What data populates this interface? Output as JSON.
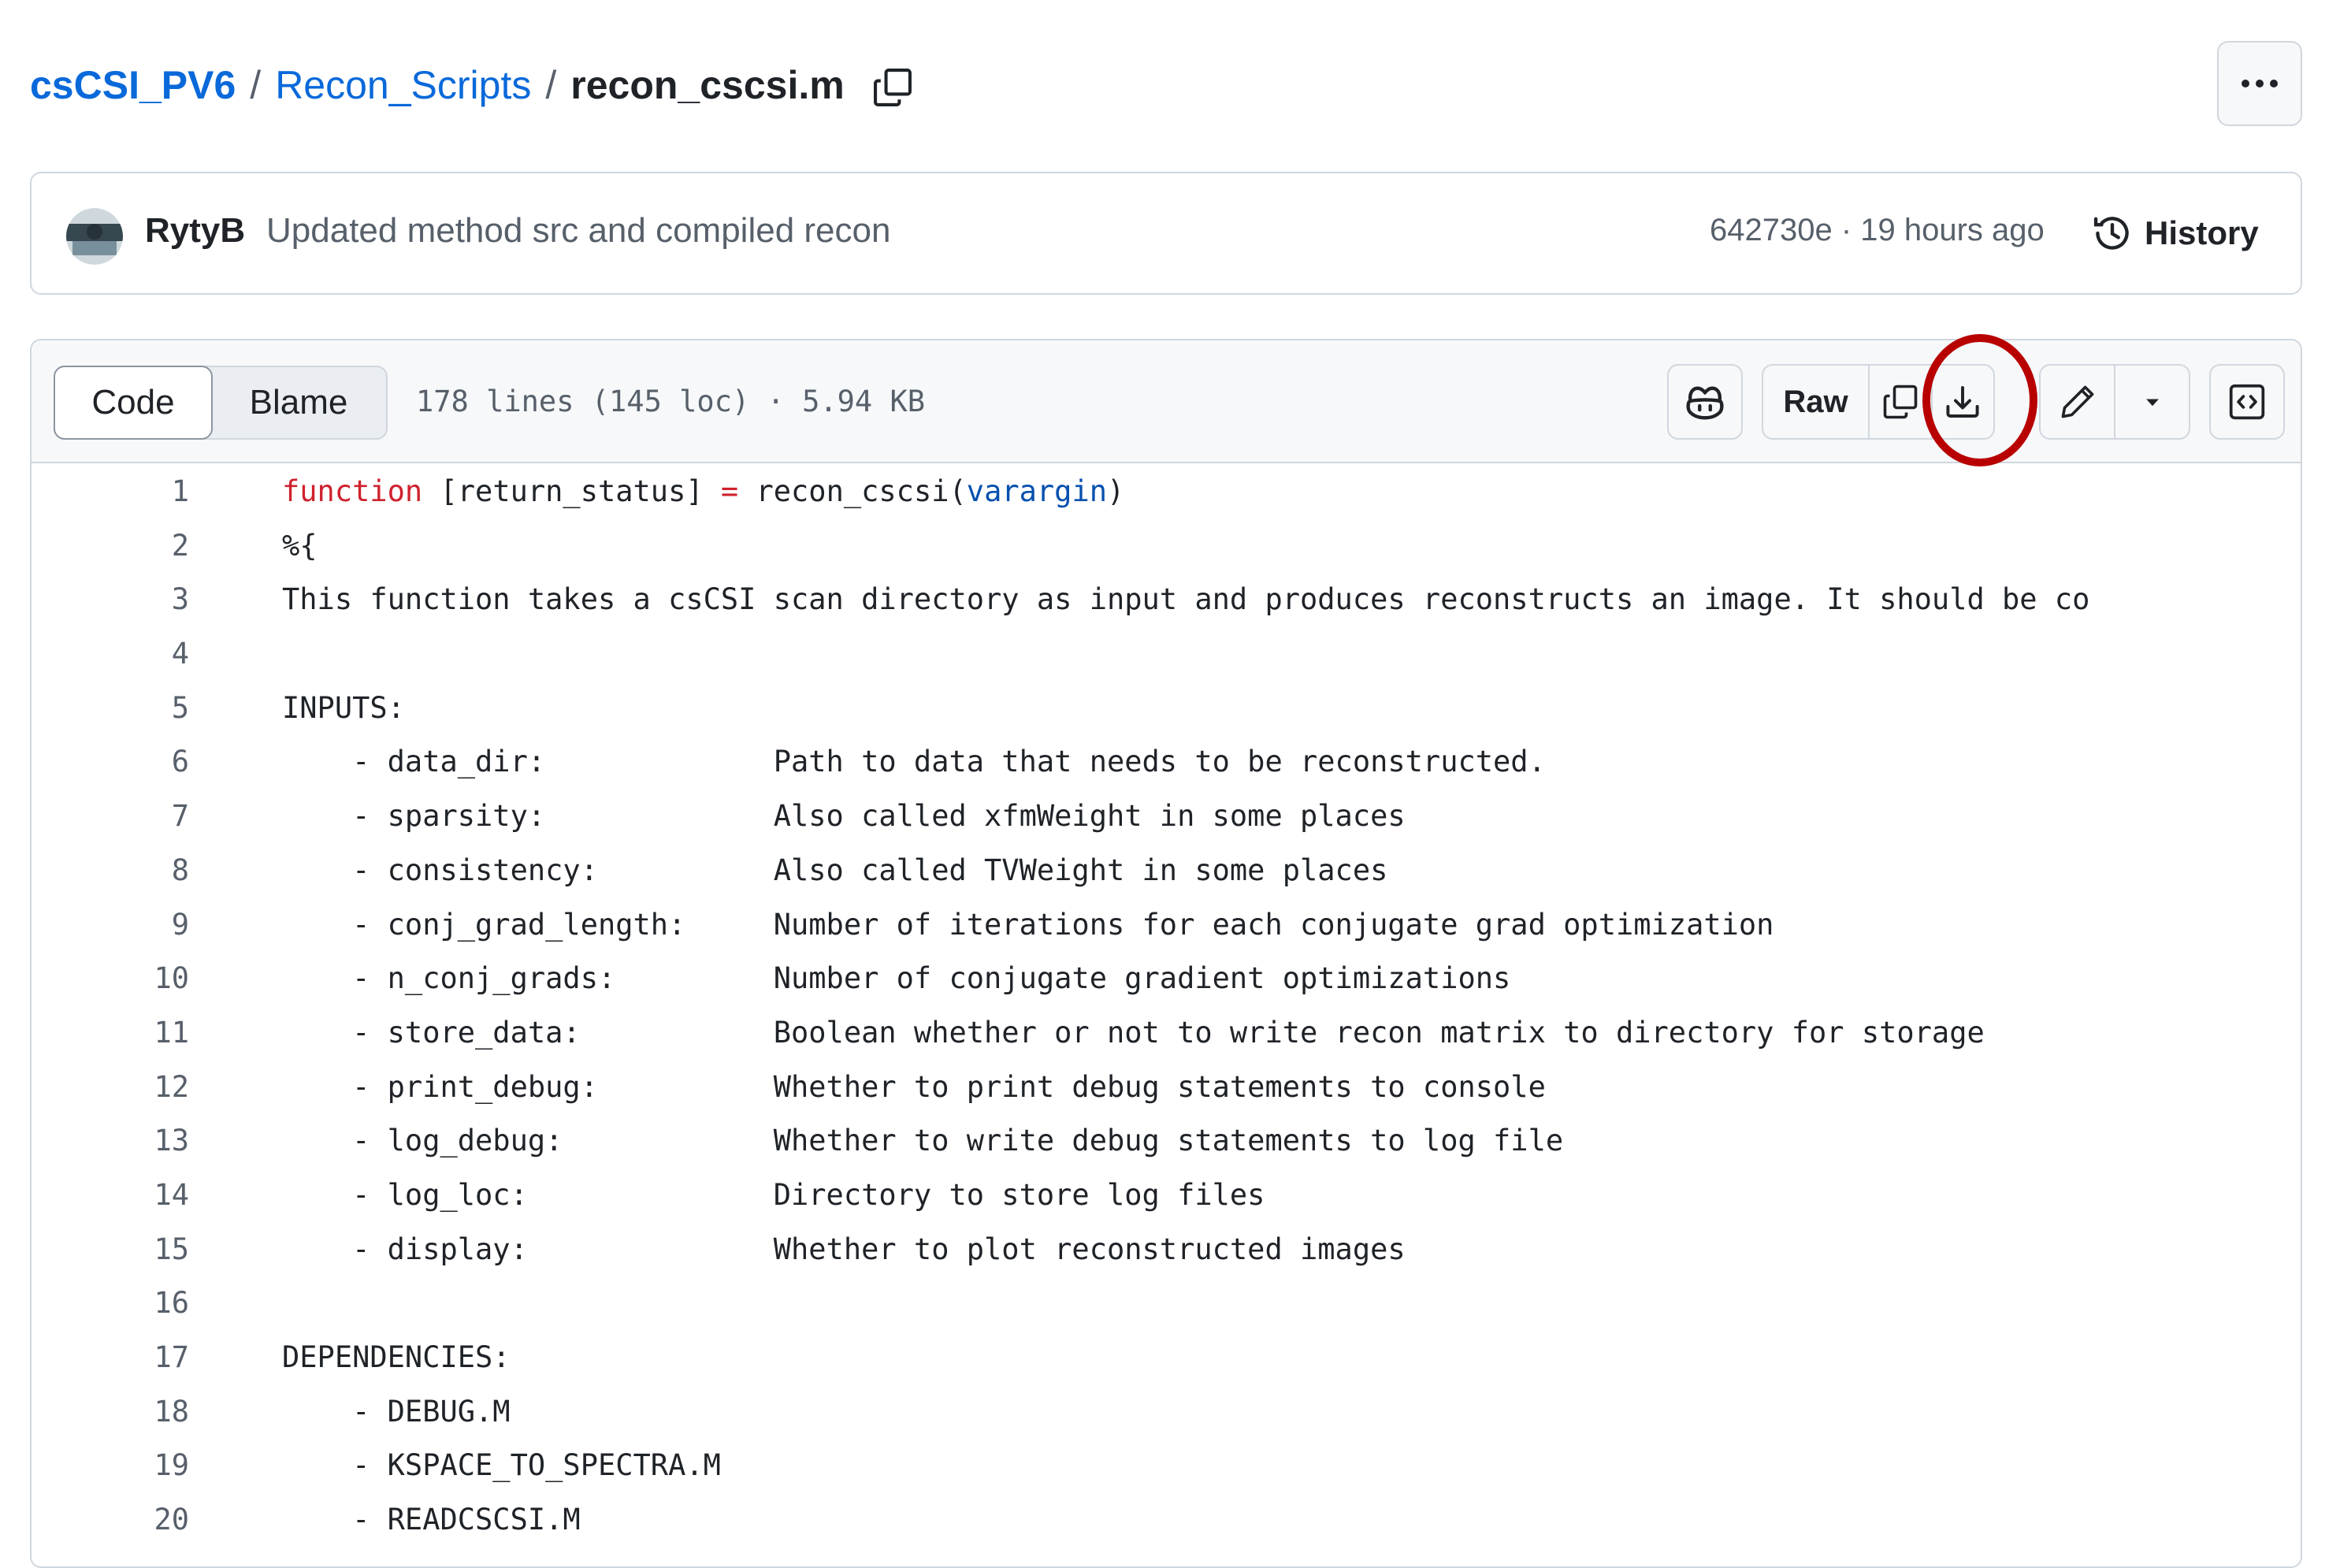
{
  "breadcrumb": {
    "repo": "csCSI_PV6",
    "separator": "/",
    "folder": "Recon_Scripts",
    "file": "recon_cscsi.m"
  },
  "icons": {
    "copy_path": "copy-icon",
    "more": "kebab-horizontal-icon",
    "history": "history-clock-icon",
    "copilot": "copilot-icon",
    "copy_raw": "copy-icon",
    "download": "download-icon",
    "edit": "pencil-icon",
    "edit_dropdown": "triangle-down-icon",
    "symbols": "code-square-icon"
  },
  "commit": {
    "author": "RytyB",
    "message": "Updated method src and compiled recon",
    "meta": "642730e · 19 hours ago",
    "history_label": "History"
  },
  "file_header": {
    "tabs": [
      "Code",
      "Blame"
    ],
    "active_tab": "Code",
    "info": "178 lines (145 loc) · 5.94 KB",
    "raw_label": "Raw"
  },
  "colors": {
    "link": "#0969da",
    "keyword": "#cf222e",
    "builtin": "#0550ae",
    "highlight_ring": "#b80000"
  },
  "code": {
    "line1": {
      "num": "1",
      "kw": "function",
      "mid": " [return_status] ",
      "op": "=",
      "fn": " recon_cscsi(",
      "arg": "varargin",
      "end": ")"
    },
    "lines": [
      {
        "num": "2",
        "text": "%{"
      },
      {
        "num": "3",
        "text": "This function takes a csCSI scan directory as input and produces reconstructs an image. It should be co"
      },
      {
        "num": "4",
        "text": ""
      },
      {
        "num": "5",
        "text": "INPUTS:"
      },
      {
        "num": "6",
        "text": "    - data_dir:             Path to data that needs to be reconstructed."
      },
      {
        "num": "7",
        "text": "    - sparsity:             Also called xfmWeight in some places"
      },
      {
        "num": "8",
        "text": "    - consistency:          Also called TVWeight in some places"
      },
      {
        "num": "9",
        "text": "    - conj_grad_length:     Number of iterations for each conjugate grad optimization"
      },
      {
        "num": "10",
        "text": "    - n_conj_grads:         Number of conjugate gradient optimizations"
      },
      {
        "num": "11",
        "text": "    - store_data:           Boolean whether or not to write recon matrix to directory for storage"
      },
      {
        "num": "12",
        "text": "    - print_debug:          Whether to print debug statements to console"
      },
      {
        "num": "13",
        "text": "    - log_debug:            Whether to write debug statements to log file"
      },
      {
        "num": "14",
        "text": "    - log_loc:              Directory to store log files"
      },
      {
        "num": "15",
        "text": "    - display:              Whether to plot reconstructed images"
      },
      {
        "num": "16",
        "text": ""
      },
      {
        "num": "17",
        "text": "DEPENDENCIES:"
      },
      {
        "num": "18",
        "text": "    - DEBUG.M"
      },
      {
        "num": "19",
        "text": "    - KSPACE_TO_SPECTRA.M"
      },
      {
        "num": "20",
        "text": "    - READCSCSI.M"
      }
    ]
  }
}
